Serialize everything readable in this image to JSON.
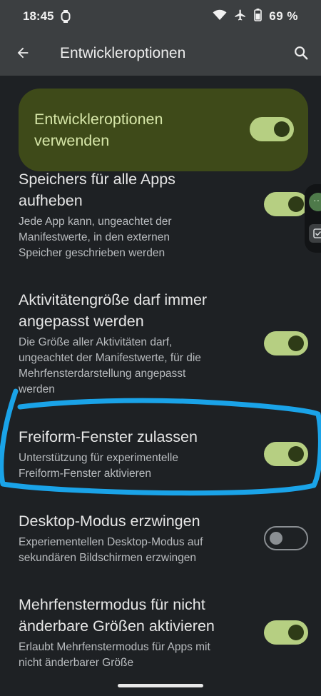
{
  "status_bar": {
    "time": "18:45",
    "battery_percent": "69 %",
    "icons": [
      "watch-icon",
      "wifi-icon",
      "airplane-icon",
      "battery-icon"
    ]
  },
  "app_bar": {
    "title": "Entwickleroptionen",
    "back_icon": "arrow-back-icon",
    "search_icon": "search-icon"
  },
  "main_toggle": {
    "label_line1": "Entwickleroptionen",
    "label_line2": "verwenden",
    "enabled": true
  },
  "settings": [
    {
      "title_line1": "Speichers für alle Apps",
      "title_line2": "aufheben",
      "desc_line1": "Jede App kann, ungeachtet der",
      "desc_line2": "Manifestwerte, in den externen",
      "desc_line3": "Speicher geschrieben werden",
      "enabled": true
    },
    {
      "title_line1": "Aktivitätengröße darf immer",
      "title_line2": "angepasst werden",
      "desc_line1": "Die Größe aller Aktivitäten darf,",
      "desc_line2": "ungeachtet der Manifestwerte, für die",
      "desc_line3": "Mehrfensterdarstellung angepasst",
      "desc_line4": "werden",
      "enabled": true
    },
    {
      "title": "Freiform-Fenster zulassen",
      "desc_line1": "Unterstützung für experimentelle",
      "desc_line2": "Freiform-Fenster aktivieren",
      "enabled": true
    },
    {
      "title": "Desktop-Modus erzwingen",
      "desc_line1": "Experiementellen Desktop-Modus auf",
      "desc_line2": "sekundären Bildschirmen erzwingen",
      "enabled": false
    },
    {
      "title_line1": "Mehrfenstermodus für nicht",
      "title_line2": "änderbare Größen aktivieren",
      "desc_line1": "Erlaubt Mehrfenstermodus für Apps mit",
      "desc_line2": "nicht änderbarer Größe",
      "enabled": true
    }
  ],
  "colors": {
    "background": "#1e2124",
    "toolbar": "#3c3f41",
    "toggle_on": "#b6cf82",
    "main_card": "#3e4a19",
    "annotation": "#1aa3e8"
  }
}
